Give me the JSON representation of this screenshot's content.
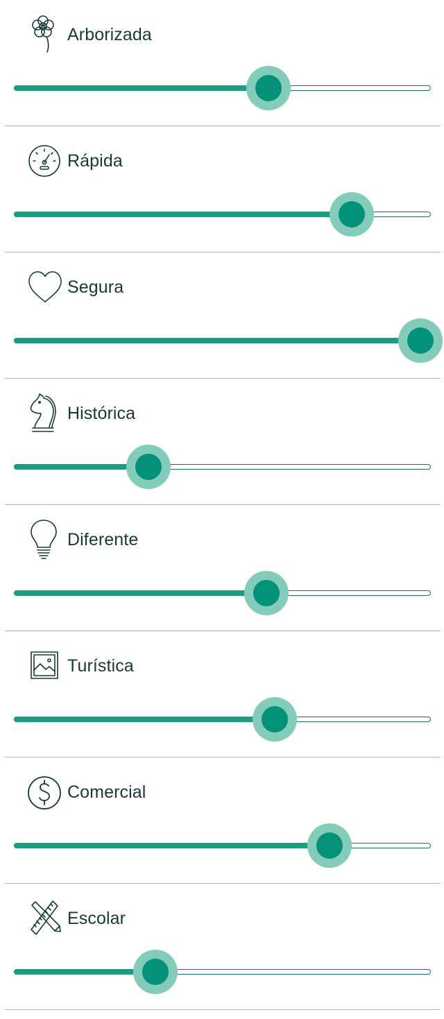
{
  "colors": {
    "track_fill": "#1c9c80",
    "track_border": "#1f6e62",
    "thumb_halo": "#82ccb9",
    "thumb_core": "#03917a",
    "text": "#173a33",
    "divider": "#a9b3b1"
  },
  "sliders": [
    {
      "id": "arborizada",
      "label": "Arborizada",
      "icon": "flower-icon",
      "value": 0.61
    },
    {
      "id": "rapida",
      "label": "Rápida",
      "icon": "speedometer-icon",
      "value": 0.81
    },
    {
      "id": "segura",
      "label": "Segura",
      "icon": "heart-icon",
      "value": 0.975
    },
    {
      "id": "historica",
      "label": "Histórica",
      "icon": "chess-knight-icon",
      "value": 0.323
    },
    {
      "id": "diferente",
      "label": "Diferente",
      "icon": "lightbulb-icon",
      "value": 0.606
    },
    {
      "id": "turistica",
      "label": "Turística",
      "icon": "picture-icon",
      "value": 0.626
    },
    {
      "id": "comercial",
      "label": "Comercial",
      "icon": "dollar-circle-icon",
      "value": 0.757
    },
    {
      "id": "escolar",
      "label": "Escolar",
      "icon": "pencil-ruler-icon",
      "value": 0.34
    }
  ]
}
